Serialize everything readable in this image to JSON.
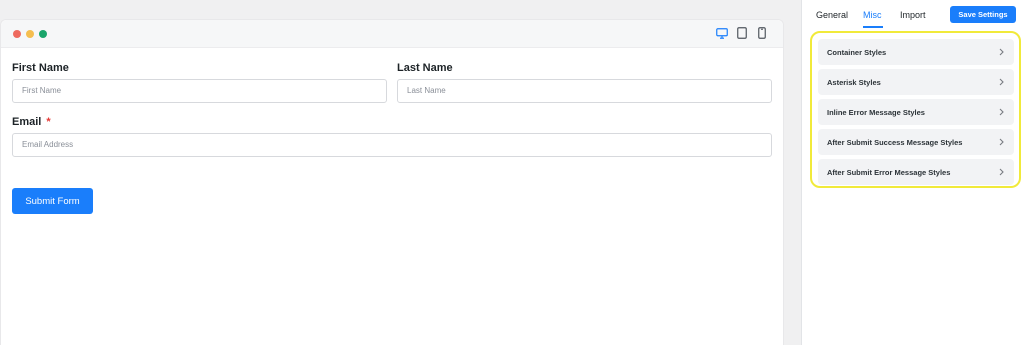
{
  "preview": {
    "form": {
      "first_name_label": "First Name",
      "first_name_placeholder": "First Name",
      "last_name_label": "Last Name",
      "last_name_placeholder": "Last Name",
      "email_label": "Email",
      "email_required_mark": "*",
      "email_placeholder": "Email Address",
      "submit_label": "Submit Form"
    }
  },
  "settings": {
    "tabs": [
      {
        "label": "General"
      },
      {
        "label": "Misc"
      },
      {
        "label": "Import"
      }
    ],
    "active_tab": "Misc",
    "save_label": "Save Settings",
    "sections": [
      {
        "label": "Container Styles"
      },
      {
        "label": "Asterisk Styles"
      },
      {
        "label": "Inline Error Message Styles"
      },
      {
        "label": "After Submit Success Message Styles"
      },
      {
        "label": "After Submit Error Message Styles"
      }
    ]
  },
  "colors": {
    "accent": "#1a7efb",
    "highlight": "#f1ea3a",
    "required": "#e53935"
  },
  "icons": {
    "device_desktop": "desktop-icon",
    "device_tablet": "tablet-icon",
    "device_mobile": "mobile-icon",
    "accordion_chevron": "chevron-right-icon"
  }
}
